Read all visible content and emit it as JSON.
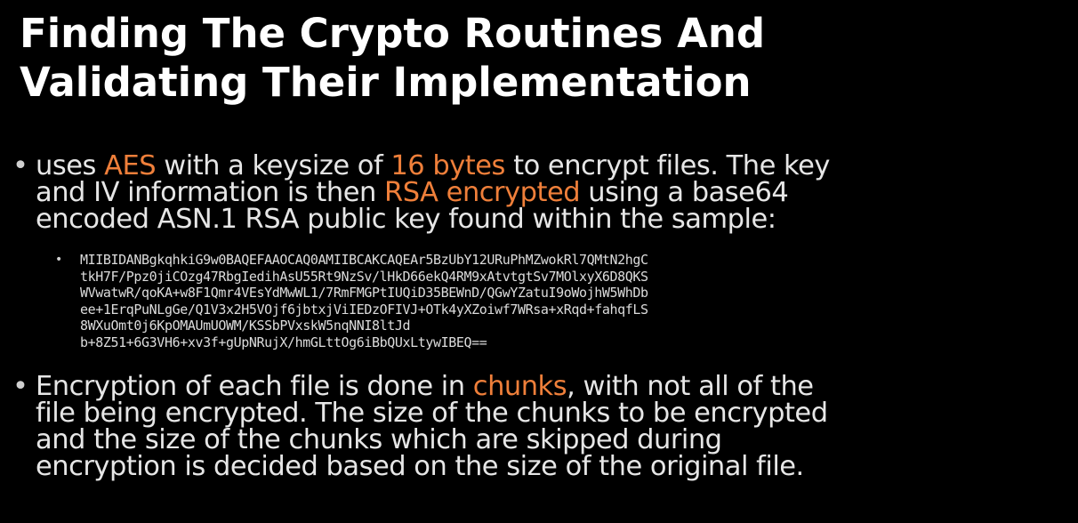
{
  "slide": {
    "title_lines": [
      "Finding The Crypto Routines And",
      "Validating Their Implementation"
    ],
    "bullet1": {
      "line1": {
        "a": "uses ",
        "b": "AES",
        "c": " with a keysize of ",
        "d": "16 bytes",
        "e": " to encrypt files. The key"
      },
      "line2": {
        "a": "and IV information is then ",
        "b": "RSA encrypted",
        "c": " using a base64"
      },
      "line3": "encoded ASN.1 RSA public key found within the sample:"
    },
    "key_lines": [
      "MIIBIDANBgkqhkiG9w0BAQEFAAOCAQ0AMIIBCAKCAQEAr5BzUbY12URuPhMZwokRl7QMtN2hgC",
      "tkH7F/Ppz0jiCOzg47RbgIedihAsU55Rt9NzSv/lHkD66ekQ4RM9xAtvtgtSv7MOlxyX6D8QKS",
      "WVwatwR/qoKA+w8F1Qmr4VEsYdMwWL1/7RmFMGPtIUQiD35BEWnD/QGwYZatuI9oWojhW5WhDb",
      "ee+1ErqPuNLgGe/Q1V3x2H5VOjf6jbtxjViIEDzOFIVJ+OTk4yXZoiwf7WRsa+xRqd+fahqfLS",
      "8WXuOmt0j6KpOMAUmUOWM/KSSbPVxskW5nqNNI8ltJd",
      "b+8Z51+6G3VH6+xv3f+gUpNRujX/hmGLttOg6iBbQUxLtywIBEQ=="
    ],
    "bullet2": {
      "line1": {
        "a": "Encryption of each file is done in ",
        "b": "chunks",
        "c": ", with not all of the"
      },
      "line2": "file being encrypted. The size of the chunks to be encrypted",
      "line3": "and the size of the chunks which are skipped during",
      "line4": "encryption is decided based on the size of the original file."
    },
    "bullet_glyph": "•"
  },
  "colors": {
    "background": "#000000",
    "title": "#ffffff",
    "text": "#e6e6e6",
    "highlight": "#ef7f3a"
  }
}
